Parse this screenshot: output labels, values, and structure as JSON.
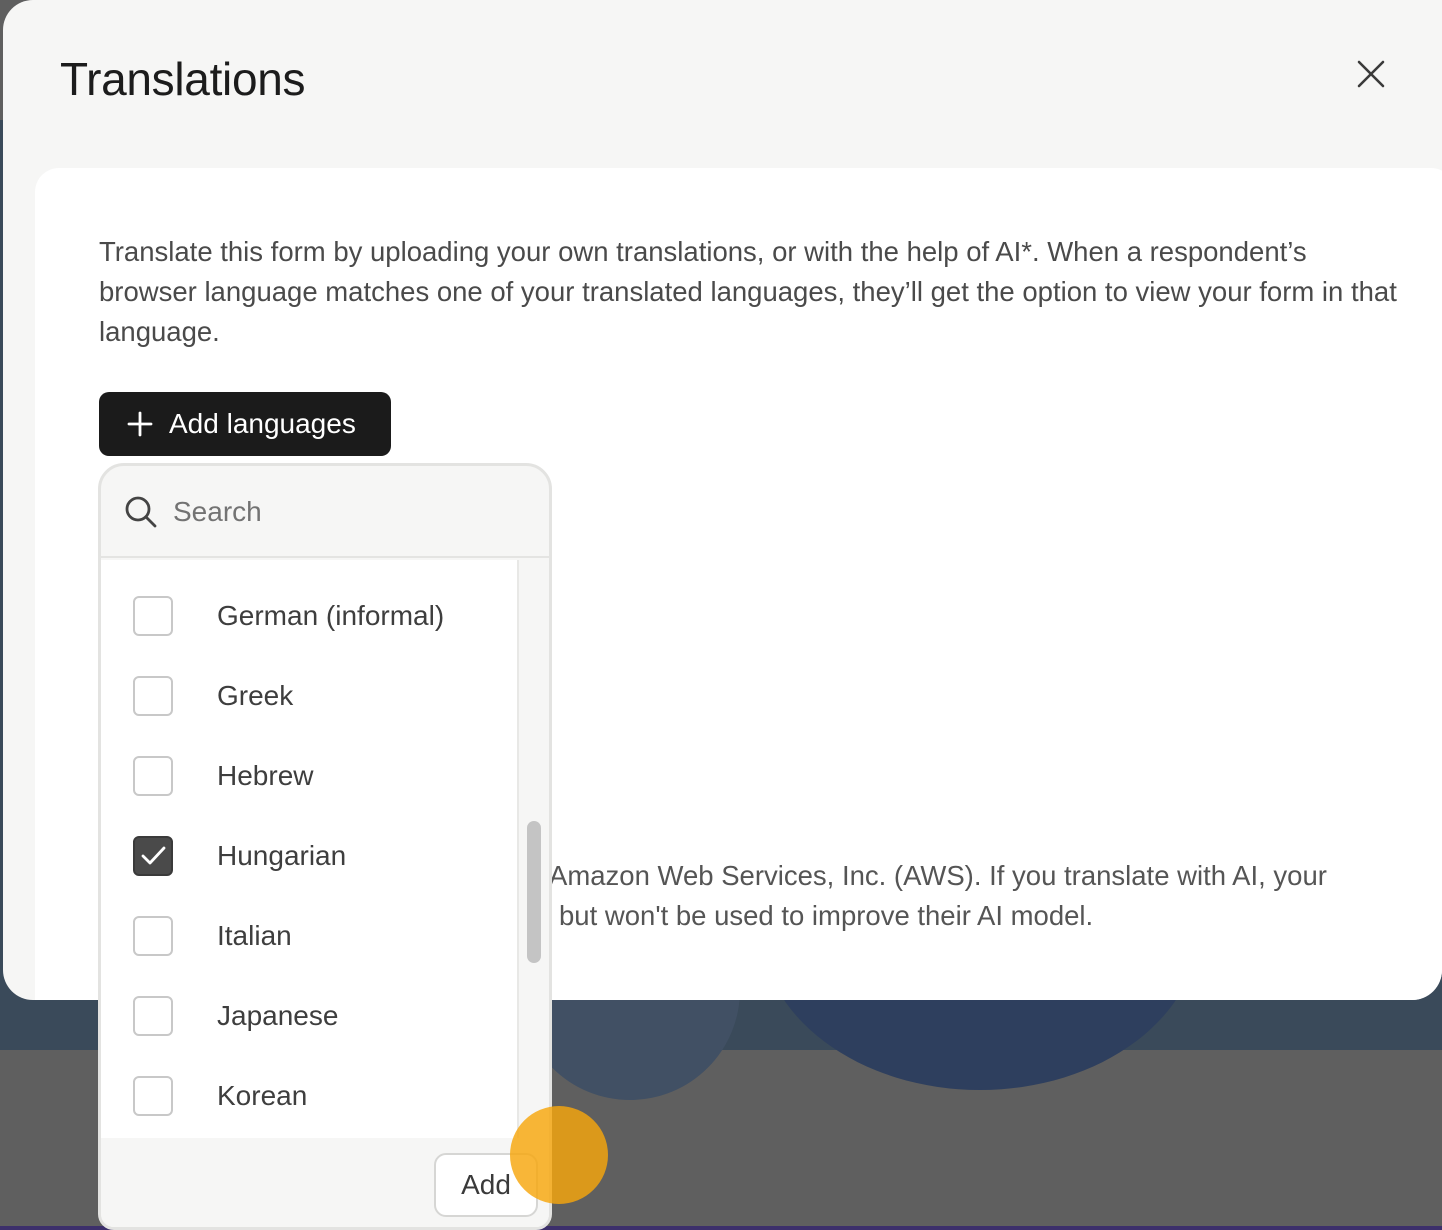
{
  "modal": {
    "title": "Translations",
    "close_icon": "close-icon",
    "intro_text": "Translate this form by uploading your own translations, or with the help of AI*. When a respondent’s browser language matches one of your translated languages, they’ll get the option to view your form in that language.",
    "add_languages_label": "Add languages",
    "plus_icon": "plus-icon",
    "disclaimer_line1": "Amazon Web Services, Inc. (AWS). If you translate with AI, your",
    "disclaimer_line2": "but won't be used to improve their AI model."
  },
  "dropdown": {
    "search_placeholder": "Search",
    "search_icon": "search-icon",
    "items": [
      {
        "label": "German (informal)",
        "checked": false
      },
      {
        "label": "Greek",
        "checked": false
      },
      {
        "label": "Hebrew",
        "checked": false
      },
      {
        "label": "Hungarian",
        "checked": true
      },
      {
        "label": "Italian",
        "checked": false
      },
      {
        "label": "Japanese",
        "checked": false
      },
      {
        "label": "Korean",
        "checked": false
      }
    ],
    "add_button_label": "Add"
  },
  "colors": {
    "primary_button": "#1b1b1b",
    "checkbox_checked": "#4a4a4a",
    "cursor_highlight": "#f7a60c"
  }
}
